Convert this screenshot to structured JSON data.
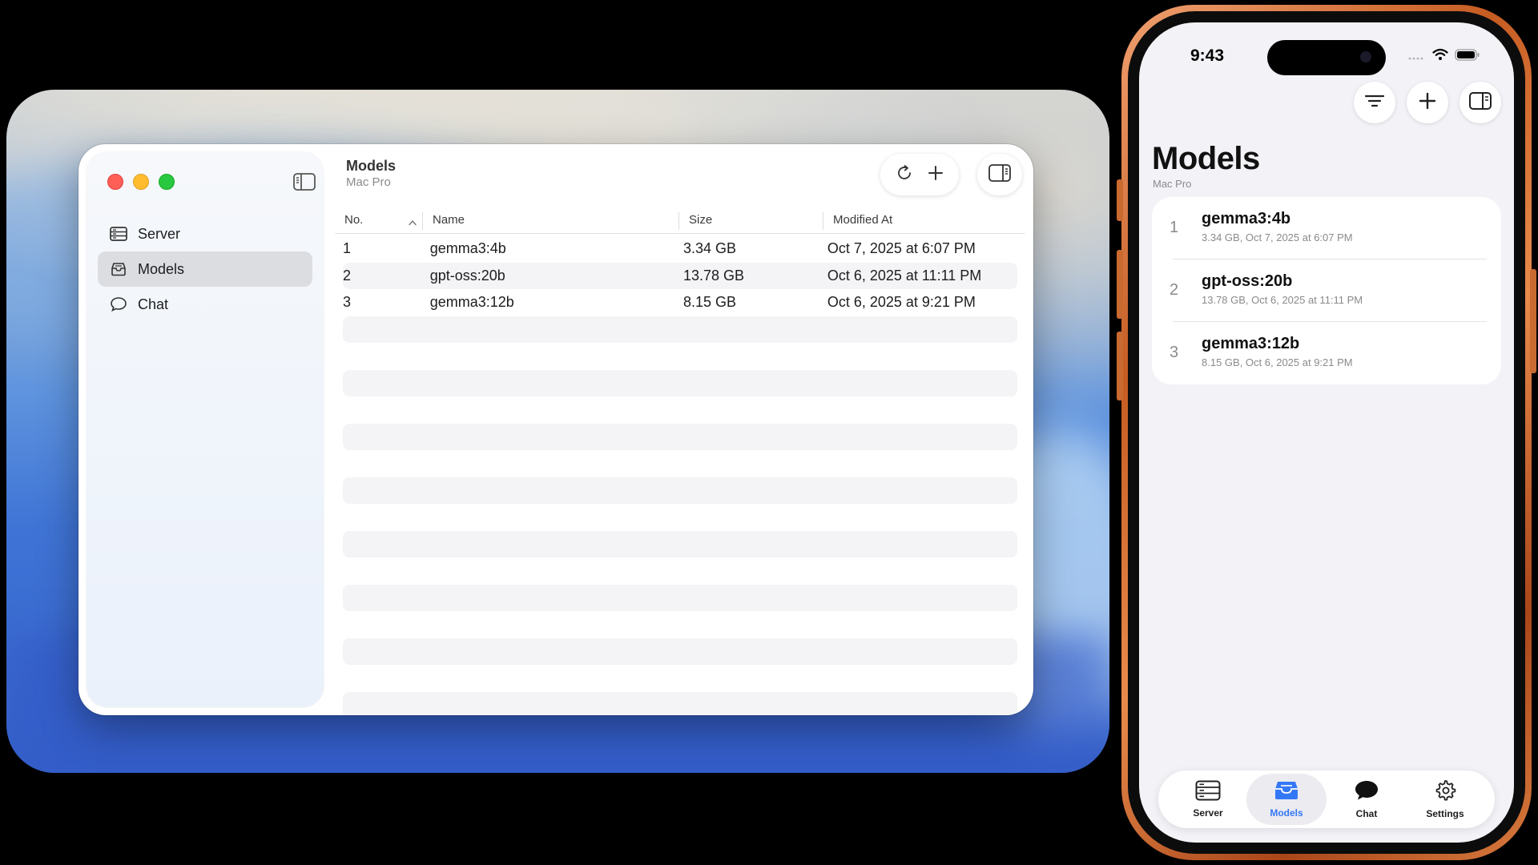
{
  "mac": {
    "title": "Models",
    "subtitle": "Mac Pro",
    "sidebar": {
      "items": [
        {
          "label": "Server",
          "icon": "server-icon"
        },
        {
          "label": "Models",
          "icon": "models-tray-icon",
          "selected": true
        },
        {
          "label": "Chat",
          "icon": "chat-bubble-icon"
        }
      ]
    },
    "toolbar": {
      "refresh_icon": "refresh-icon",
      "add_icon": "plus-icon",
      "inspector_icon": "sidebar-right-icon"
    },
    "table": {
      "columns": [
        "No.",
        "Name",
        "Size",
        "Modified At"
      ],
      "sort_column": "No.",
      "rows": [
        {
          "no": "1",
          "name": "gemma3:4b",
          "size": "3.34 GB",
          "modified": "Oct 7, 2025 at 6:07 PM"
        },
        {
          "no": "2",
          "name": "gpt-oss:20b",
          "size": "13.78 GB",
          "modified": "Oct 6, 2025 at 11:11 PM"
        },
        {
          "no": "3",
          "name": "gemma3:12b",
          "size": "8.15 GB",
          "modified": "Oct 6, 2025 at 9:21 PM"
        }
      ]
    }
  },
  "phone": {
    "status_time": "9:43",
    "title": "Models",
    "subtitle": "Mac Pro",
    "list": [
      {
        "no": "1",
        "name": "gemma3:4b",
        "detail": "3.34 GB, Oct 7, 2025 at 6:07 PM"
      },
      {
        "no": "2",
        "name": "gpt-oss:20b",
        "detail": "13.78 GB, Oct 6, 2025 at 11:11 PM"
      },
      {
        "no": "3",
        "name": "gemma3:12b",
        "detail": "8.15 GB, Oct 6, 2025 at 9:21 PM"
      }
    ],
    "tabs": [
      {
        "label": "Server",
        "icon": "server-icon"
      },
      {
        "label": "Models",
        "icon": "models-tray-icon",
        "selected": true
      },
      {
        "label": "Chat",
        "icon": "chat-bubble-icon"
      },
      {
        "label": "Settings",
        "icon": "gear-icon"
      }
    ]
  },
  "colors": {
    "accent": "#3478f6",
    "close": "#ff5f57",
    "minimize": "#febc2e",
    "zoom": "#28c840",
    "phone_frame": "#c65c22"
  }
}
